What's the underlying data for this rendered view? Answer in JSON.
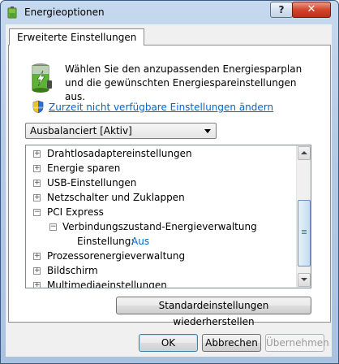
{
  "window": {
    "title": "Energieoptionen",
    "help_label": "?",
    "close_label": "✕"
  },
  "tab": {
    "label": "Erweiterte Einstellungen"
  },
  "description": "Wählen Sie den anzupassenden Energiesparplan und die gewünschten Energiespareinstellungen aus.",
  "link": {
    "label": "Zurzeit nicht verfügbare Einstellungen ändern"
  },
  "plan_select": {
    "value": "Ausbalanciert [Aktiv]"
  },
  "tree": {
    "items": [
      {
        "label": "Drahtlosadaptereinstellungen",
        "expander": "+"
      },
      {
        "label": "Energie sparen",
        "expander": "+"
      },
      {
        "label": "USB-Einstellungen",
        "expander": "+"
      },
      {
        "label": "Netzschalter und Zuklappen",
        "expander": "+"
      },
      {
        "label": "PCI Express",
        "expander": "−"
      },
      {
        "label": "Verbindungszustand-Energieverwaltung",
        "expander": "−"
      },
      {
        "label": "Einstellung:",
        "value": "Aus"
      },
      {
        "label": "Prozessorenergieverwaltung",
        "expander": "+"
      },
      {
        "label": "Bildschirm",
        "expander": "+"
      },
      {
        "label": "Multimediaeinstellungen",
        "expander": "+"
      }
    ]
  },
  "buttons": {
    "restore": "Standardeinstellungen wiederherstellen",
    "ok": "OK",
    "cancel": "Abbrechen",
    "apply": "Übernehmen"
  },
  "colors": {
    "link": "#0066cc",
    "close": "#c7402a",
    "title_glass": "#b4cbe6"
  }
}
